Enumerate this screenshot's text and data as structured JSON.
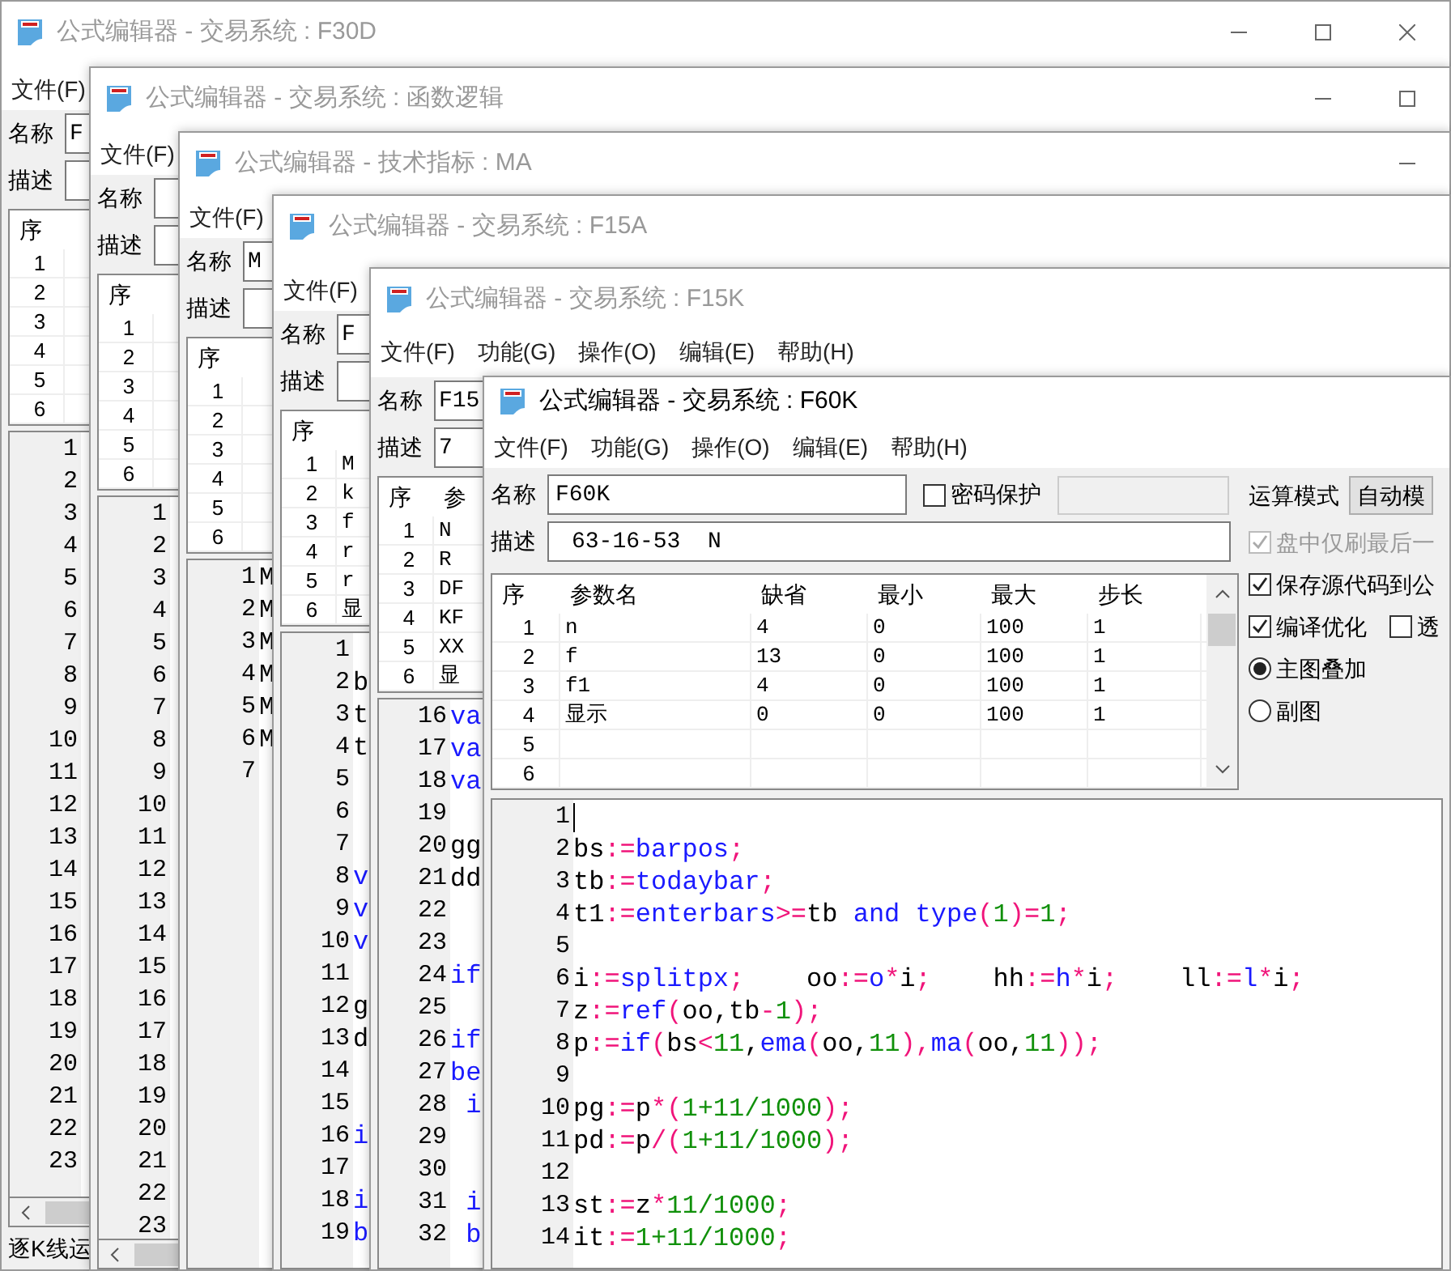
{
  "windows": [
    {
      "title": "公式编辑器 - 交易系统 : F30D",
      "menu": [
        "文件(F)"
      ],
      "name_label": "名称",
      "name_value": "F",
      "desc_label": "描述",
      "params": {
        "columns": [
          "序"
        ],
        "rows": [
          [
            "1"
          ],
          [
            "2"
          ],
          [
            "3"
          ],
          [
            "4"
          ],
          [
            "5"
          ],
          [
            "6"
          ]
        ]
      },
      "code": [
        {
          "number": "1"
        },
        {
          "number": "2"
        },
        {
          "number": "3"
        },
        {
          "number": "4"
        },
        {
          "number": "5"
        },
        {
          "number": "6"
        },
        {
          "number": "7"
        },
        {
          "number": "8"
        },
        {
          "number": "9"
        },
        {
          "number": "10"
        },
        {
          "number": "11"
        },
        {
          "number": "12"
        },
        {
          "number": "13"
        },
        {
          "number": "14"
        },
        {
          "number": "15"
        },
        {
          "number": "16"
        },
        {
          "number": "17"
        },
        {
          "number": "18"
        },
        {
          "number": "19"
        },
        {
          "number": "20"
        },
        {
          "number": "21"
        },
        {
          "number": "22"
        },
        {
          "number": "23"
        }
      ],
      "h_scrollbar": true,
      "status": "逐K线运"
    },
    {
      "title": "公式编辑器 - 交易系统 : 函数逻辑",
      "menu": [
        "文件(F)"
      ],
      "name_label": "名称",
      "desc_label": "描述",
      "params": {
        "columns": [
          "序"
        ],
        "rows": [
          [
            "1"
          ],
          [
            "2"
          ],
          [
            "3"
          ],
          [
            "4"
          ],
          [
            "5"
          ],
          [
            "6"
          ]
        ]
      },
      "code": [
        {
          "number": "1"
        },
        {
          "number": "2"
        },
        {
          "number": "3"
        },
        {
          "number": "4"
        },
        {
          "number": "5"
        },
        {
          "number": "6"
        },
        {
          "number": "7"
        },
        {
          "number": "8"
        },
        {
          "number": "9"
        },
        {
          "number": "10"
        },
        {
          "number": "11"
        },
        {
          "number": "12"
        },
        {
          "number": "13"
        },
        {
          "number": "14"
        },
        {
          "number": "15"
        },
        {
          "number": "16"
        },
        {
          "number": "17"
        },
        {
          "number": "18"
        },
        {
          "number": "19"
        },
        {
          "number": "20"
        },
        {
          "number": "21"
        },
        {
          "number": "22"
        },
        {
          "number": "23"
        }
      ],
      "h_scrollbar": true
    },
    {
      "title": "公式编辑器 - 技术指标 : MA",
      "menu": [
        "文件(F)"
      ],
      "name_label": "名称",
      "name_value": "M",
      "desc_label": "描述",
      "params": {
        "columns": [
          "序"
        ],
        "rows": [
          [
            "1"
          ],
          [
            "2"
          ],
          [
            "3"
          ],
          [
            "4"
          ],
          [
            "5"
          ],
          [
            "6"
          ]
        ]
      },
      "code": [
        {
          "number": "1",
          "tokens": [
            {
              "text": "M",
              "kind": "var"
            }
          ]
        },
        {
          "number": "2",
          "tokens": [
            {
              "text": "M",
              "kind": "var"
            }
          ]
        },
        {
          "number": "3",
          "tokens": [
            {
              "text": "M",
              "kind": "var"
            }
          ]
        },
        {
          "number": "4",
          "tokens": [
            {
              "text": "M",
              "kind": "var"
            }
          ]
        },
        {
          "number": "5",
          "tokens": [
            {
              "text": "M",
              "kind": "var"
            }
          ]
        },
        {
          "number": "6",
          "tokens": [
            {
              "text": "M",
              "kind": "var"
            }
          ]
        },
        {
          "number": "7"
        }
      ]
    },
    {
      "title": "公式编辑器 - 交易系统 : F15A",
      "menu": [
        "文件(F)"
      ],
      "name_label": "名称",
      "name_value": "F",
      "desc_label": "描述",
      "params": {
        "columns": [
          "序"
        ],
        "rows": [
          [
            "1",
            "M"
          ],
          [
            "2",
            "k"
          ],
          [
            "3",
            "f"
          ],
          [
            "4",
            "r"
          ],
          [
            "5",
            "r"
          ],
          [
            "6",
            "显"
          ]
        ]
      },
      "code": [
        {
          "number": "1"
        },
        {
          "number": "2",
          "tokens": [
            {
              "text": "b",
              "kind": "var"
            }
          ]
        },
        {
          "number": "3",
          "tokens": [
            {
              "text": "t",
              "kind": "var"
            }
          ]
        },
        {
          "number": "4",
          "tokens": [
            {
              "text": "t",
              "kind": "var"
            }
          ]
        },
        {
          "number": "5"
        },
        {
          "number": "6"
        },
        {
          "number": "7"
        },
        {
          "number": "8",
          "tokens": [
            {
              "text": "v",
              "kind": "fn"
            }
          ]
        },
        {
          "number": "9",
          "tokens": [
            {
              "text": "v",
              "kind": "fn"
            }
          ]
        },
        {
          "number": "10",
          "tokens": [
            {
              "text": "v",
              "kind": "fn"
            }
          ]
        },
        {
          "number": "11"
        },
        {
          "number": "12",
          "tokens": [
            {
              "text": "g",
              "kind": "var"
            }
          ]
        },
        {
          "number": "13",
          "tokens": [
            {
              "text": "d",
              "kind": "var"
            }
          ]
        },
        {
          "number": "14"
        },
        {
          "number": "15"
        },
        {
          "number": "16",
          "tokens": [
            {
              "text": "i",
              "kind": "fn"
            }
          ]
        },
        {
          "number": "17"
        },
        {
          "number": "18",
          "tokens": [
            {
              "text": "i",
              "kind": "fn"
            }
          ]
        },
        {
          "number": "19",
          "tokens": [
            {
              "text": "b",
              "kind": "fn"
            }
          ]
        }
      ]
    },
    {
      "title": "公式编辑器 - 交易系统 : F15K",
      "menu": [
        "文件(F)",
        "功能(G)",
        "操作(O)",
        "编辑(E)",
        "帮助(H)"
      ],
      "name_label": "名称",
      "name_value": "F15",
      "desc_label": "描述",
      "desc_value": "7",
      "params": {
        "columns": [
          "序",
          "参"
        ],
        "rows": [
          [
            "1",
            "N"
          ],
          [
            "2",
            "R"
          ],
          [
            "3",
            "DF"
          ],
          [
            "4",
            "KF"
          ],
          [
            "5",
            "XX"
          ],
          [
            "6",
            "显"
          ]
        ]
      },
      "code": [
        {
          "number": "16",
          "tokens": [
            {
              "text": "va",
              "kind": "fn"
            }
          ]
        },
        {
          "number": "17",
          "tokens": [
            {
              "text": "va",
              "kind": "fn"
            }
          ]
        },
        {
          "number": "18",
          "tokens": [
            {
              "text": "va",
              "kind": "fn"
            }
          ]
        },
        {
          "number": "19"
        },
        {
          "number": "20",
          "tokens": [
            {
              "text": "gg",
              "kind": "var"
            }
          ]
        },
        {
          "number": "21",
          "tokens": [
            {
              "text": "dd",
              "kind": "var"
            }
          ]
        },
        {
          "number": "22"
        },
        {
          "number": "23"
        },
        {
          "number": "24",
          "tokens": [
            {
              "text": "if",
              "kind": "fn"
            }
          ]
        },
        {
          "number": "25"
        },
        {
          "number": "26",
          "tokens": [
            {
              "text": "if",
              "kind": "fn"
            }
          ]
        },
        {
          "number": "27",
          "tokens": [
            {
              "text": "be",
              "kind": "fn"
            }
          ]
        },
        {
          "number": "28",
          "tokens": [
            {
              "text": " i",
              "kind": "fn"
            }
          ]
        },
        {
          "number": "29"
        },
        {
          "number": "30"
        },
        {
          "number": "31",
          "tokens": [
            {
              "text": " i",
              "kind": "fn"
            }
          ]
        },
        {
          "number": "32",
          "tokens": [
            {
              "text": " b",
              "kind": "fn"
            }
          ]
        }
      ]
    },
    {
      "title": "公式编辑器 - 交易系统 : F60K",
      "active": true,
      "menu": [
        "文件(F)",
        "功能(G)",
        "操作(O)",
        "编辑(E)",
        "帮助(H)"
      ],
      "name_label": "名称",
      "name_value": "F60K",
      "password": {
        "label": "密码保护",
        "checked": false
      },
      "desc_label": "描述",
      "desc_value": "63-16-53  N",
      "params": {
        "columns": [
          "序",
          "参数名",
          "缺省",
          "最小",
          "最大",
          "步长"
        ],
        "rows": [
          [
            "1",
            "n",
            "4",
            "0",
            "100",
            "1"
          ],
          [
            "2",
            "f",
            "13",
            "0",
            "100",
            "1"
          ],
          [
            "3",
            "f1",
            "4",
            "0",
            "100",
            "1"
          ],
          [
            "4",
            "显示",
            "0",
            "0",
            "100",
            "1"
          ],
          [
            "5"
          ],
          [
            "6"
          ]
        ]
      },
      "mode": {
        "label": "运算模式",
        "value": "自动模"
      },
      "options": [
        {
          "label": "盘中仅刷最后一",
          "checked": true,
          "disabled": true
        },
        {
          "label": "保存源代码到公",
          "checked": true,
          "disabled": false
        }
      ],
      "options_row": [
        {
          "label": "编译优化",
          "checked": true
        },
        {
          "label": "透",
          "checked": false
        }
      ],
      "radios": [
        {
          "label": "主图叠加",
          "selected": true
        },
        {
          "label": "副图",
          "selected": false
        }
      ],
      "code": [
        {
          "number": "1"
        },
        {
          "number": "2",
          "tokens": [
            {
              "text": "bs",
              "kind": "var"
            },
            {
              "text": ":=",
              "kind": "op"
            },
            {
              "text": "barpos",
              "kind": "fn"
            },
            {
              "text": ";",
              "kind": "op"
            }
          ]
        },
        {
          "number": "3",
          "tokens": [
            {
              "text": "tb",
              "kind": "var"
            },
            {
              "text": ":=",
              "kind": "op"
            },
            {
              "text": "todaybar",
              "kind": "fn"
            },
            {
              "text": ";",
              "kind": "op"
            }
          ]
        },
        {
          "number": "4",
          "tokens": [
            {
              "text": "t1",
              "kind": "var"
            },
            {
              "text": ":=",
              "kind": "op"
            },
            {
              "text": "enterbars",
              "kind": "fn"
            },
            {
              "text": ">=",
              "kind": "op"
            },
            {
              "text": "tb ",
              "kind": "var"
            },
            {
              "text": "and",
              "kind": "fn"
            },
            {
              "text": " type",
              "kind": "fn"
            },
            {
              "text": "(",
              "kind": "op"
            },
            {
              "text": "1",
              "kind": "num"
            },
            {
              "text": ")=",
              "kind": "op"
            },
            {
              "text": "1",
              "kind": "num"
            },
            {
              "text": ";",
              "kind": "op"
            }
          ]
        },
        {
          "number": "5"
        },
        {
          "number": "6",
          "tokens": [
            {
              "text": "i",
              "kind": "var"
            },
            {
              "text": ":=",
              "kind": "op"
            },
            {
              "text": "splitpx",
              "kind": "fn"
            },
            {
              "text": ";",
              "kind": "op"
            },
            {
              "text": "    oo",
              "kind": "var"
            },
            {
              "text": ":=",
              "kind": "op"
            },
            {
              "text": "o",
              "kind": "fn"
            },
            {
              "text": "*",
              "kind": "op"
            },
            {
              "text": "i",
              "kind": "var"
            },
            {
              "text": ";",
              "kind": "op"
            },
            {
              "text": "    hh",
              "kind": "var"
            },
            {
              "text": ":=",
              "kind": "op"
            },
            {
              "text": "h",
              "kind": "fn"
            },
            {
              "text": "*",
              "kind": "op"
            },
            {
              "text": "i",
              "kind": "var"
            },
            {
              "text": ";",
              "kind": "op"
            },
            {
              "text": "    ll",
              "kind": "var"
            },
            {
              "text": ":=",
              "kind": "op"
            },
            {
              "text": "l",
              "kind": "fn"
            },
            {
              "text": "*",
              "kind": "op"
            },
            {
              "text": "i",
              "kind": "var"
            },
            {
              "text": ";",
              "kind": "op"
            }
          ]
        },
        {
          "number": "7",
          "tokens": [
            {
              "text": "z",
              "kind": "var"
            },
            {
              "text": ":=",
              "kind": "op"
            },
            {
              "text": "ref",
              "kind": "fn"
            },
            {
              "text": "(",
              "kind": "op"
            },
            {
              "text": "oo,tb",
              "kind": "var"
            },
            {
              "text": "-",
              "kind": "op"
            },
            {
              "text": "1",
              "kind": "num"
            },
            {
              "text": ");",
              "kind": "op"
            }
          ]
        },
        {
          "number": "8",
          "tokens": [
            {
              "text": "p",
              "kind": "var"
            },
            {
              "text": ":=",
              "kind": "op"
            },
            {
              "text": "if",
              "kind": "fn"
            },
            {
              "text": "(",
              "kind": "op"
            },
            {
              "text": "bs",
              "kind": "var"
            },
            {
              "text": "<",
              "kind": "op"
            },
            {
              "text": "11",
              "kind": "num"
            },
            {
              "text": ",",
              "kind": "var"
            },
            {
              "text": "ema",
              "kind": "fn"
            },
            {
              "text": "(",
              "kind": "op"
            },
            {
              "text": "oo,",
              "kind": "var"
            },
            {
              "text": "11",
              "kind": "num"
            },
            {
              "text": "),",
              "kind": "op"
            },
            {
              "text": "ma",
              "kind": "fn"
            },
            {
              "text": "(",
              "kind": "op"
            },
            {
              "text": "oo,",
              "kind": "var"
            },
            {
              "text": "11",
              "kind": "num"
            },
            {
              "text": "));",
              "kind": "op"
            }
          ]
        },
        {
          "number": "9"
        },
        {
          "number": "10",
          "tokens": [
            {
              "text": "pg",
              "kind": "var"
            },
            {
              "text": ":=",
              "kind": "op"
            },
            {
              "text": "p",
              "kind": "var"
            },
            {
              "text": "*(",
              "kind": "op"
            },
            {
              "text": "1+11/1000",
              "kind": "num"
            },
            {
              "text": ");",
              "kind": "op"
            }
          ]
        },
        {
          "number": "11",
          "tokens": [
            {
              "text": "pd",
              "kind": "var"
            },
            {
              "text": ":=",
              "kind": "op"
            },
            {
              "text": "p",
              "kind": "var"
            },
            {
              "text": "/(",
              "kind": "op"
            },
            {
              "text": "1+11/1000",
              "kind": "num"
            },
            {
              "text": ");",
              "kind": "op"
            }
          ]
        },
        {
          "number": "12"
        },
        {
          "number": "13",
          "tokens": [
            {
              "text": "st",
              "kind": "var"
            },
            {
              "text": ":=",
              "kind": "op"
            },
            {
              "text": "z",
              "kind": "var"
            },
            {
              "text": "*",
              "kind": "op"
            },
            {
              "text": "11/1000",
              "kind": "num"
            },
            {
              "text": ";",
              "kind": "op"
            }
          ]
        },
        {
          "number": "14",
          "tokens": [
            {
              "text": "it",
              "kind": "var"
            },
            {
              "text": ":=",
              "kind": "op"
            },
            {
              "text": "1+11/1000",
              "kind": "num"
            },
            {
              "text": ";",
              "kind": "op"
            }
          ]
        }
      ]
    }
  ]
}
